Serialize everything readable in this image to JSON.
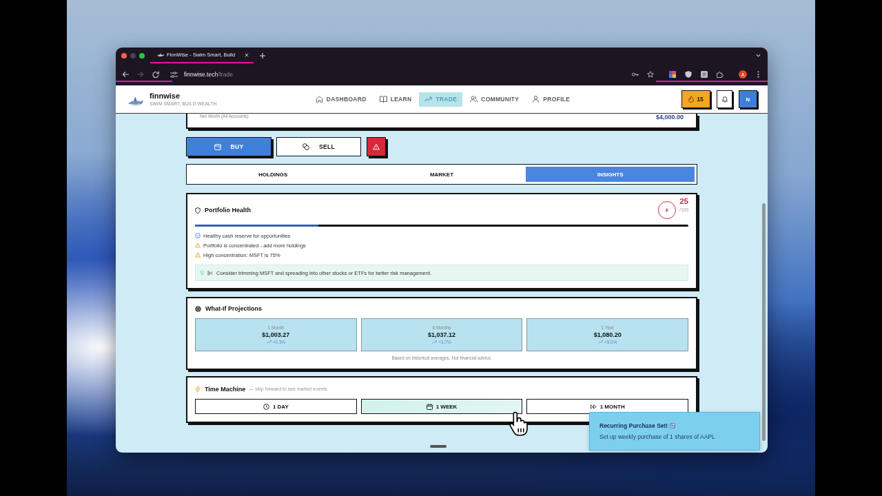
{
  "browser": {
    "tab_title": "FinnWise - Swim Smart, Build",
    "url_host": "finnwise.tech",
    "url_path": "/trade",
    "profile_initial": "A"
  },
  "header": {
    "brand": "finnwise",
    "tagline": "SWIM SMART, BUILD WEALTH",
    "nav": [
      {
        "label": "DASHBOARD",
        "selected": false
      },
      {
        "label": "LEARN",
        "selected": false
      },
      {
        "label": "TRADE",
        "selected": true
      },
      {
        "label": "COMMUNITY",
        "selected": false
      },
      {
        "label": "PROFILE",
        "selected": false
      }
    ],
    "streak": "15",
    "avatar": "N"
  },
  "net_worth": {
    "label": "Net Worth (All Accounts)",
    "value": "$4,000.00"
  },
  "actions": [
    {
      "kind": "buy",
      "label": "BUY"
    },
    {
      "kind": "sell",
      "label": "SELL"
    },
    {
      "kind": "alert"
    }
  ],
  "tabs": [
    {
      "label": "HOLDINGS",
      "selected": false
    },
    {
      "label": "MARKET",
      "selected": false
    },
    {
      "label": "INSIGHTS",
      "selected": true
    }
  ],
  "health": {
    "title": "Portfolio Health",
    "grade": "F",
    "score": "25",
    "max": "/100",
    "level": 0.25,
    "checks": [
      {
        "kind": "ok",
        "text": "Healthy cash reserve for opportunities"
      },
      {
        "kind": "warning",
        "text": "Portfolio is concentrated - add more holdings"
      },
      {
        "kind": "warning",
        "text": "High concentration: MSFT is 75%"
      }
    ],
    "tip": "Consider trimming MSFT and spreading into other stocks or ETFs for better risk management."
  },
  "projections": {
    "title": "What-If Projections",
    "items": [
      {
        "period": "1 Month",
        "value": "$1,003.27",
        "change": "+0.3%"
      },
      {
        "period": "6 Months",
        "value": "$1,037.12",
        "change": "+3.7%"
      },
      {
        "period": "1 Year",
        "value": "$1,080.20",
        "change": "+8.0%"
      }
    ],
    "note": "Based on historical averages. Not financial advice."
  },
  "time_machine": {
    "title": "Time Machine",
    "subtitle": "— skip forward to see market events",
    "options": [
      {
        "label": "1 DAY",
        "hovered": false
      },
      {
        "label": "1 WEEK",
        "hovered": true
      },
      {
        "label": "1 MONTH",
        "hovered": false
      }
    ]
  },
  "toast": {
    "title": "Recurring Purchase Set!",
    "message": "Set up weekly purchase of 1 shares of AAPL"
  }
}
